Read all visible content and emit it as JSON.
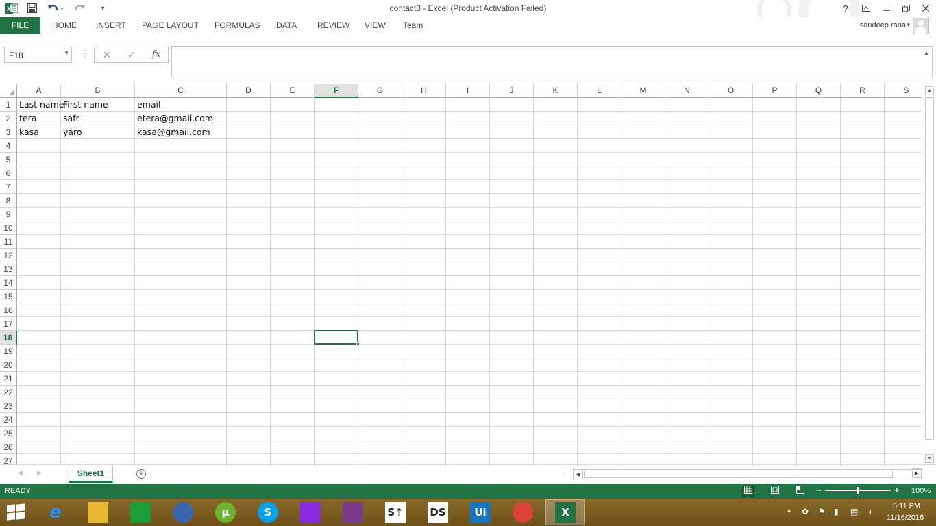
{
  "window": {
    "title": "contact3 - Excel (Product Activation Failed)",
    "help": "?",
    "user_name": "sandeep rana"
  },
  "ribbon": {
    "file": "FILE",
    "tabs": [
      "HOME",
      "INSERT",
      "PAGE LAYOUT",
      "FORMULAS",
      "DATA",
      "REVIEW",
      "VIEW",
      "Team"
    ]
  },
  "formula_bar": {
    "name_box": "F18",
    "fx_label": "fx",
    "cancel_glyph": "✕",
    "enter_glyph": "✓",
    "value": ""
  },
  "grid": {
    "columns": [
      "A",
      "B",
      "C",
      "D",
      "E",
      "F",
      "G",
      "H",
      "I",
      "J",
      "K",
      "L",
      "M",
      "N",
      "O",
      "P",
      "Q",
      "R",
      "S"
    ],
    "rows": [
      "1",
      "2",
      "3",
      "4",
      "5",
      "6",
      "7",
      "8",
      "9",
      "10",
      "11",
      "12",
      "13",
      "14",
      "15",
      "16",
      "17",
      "18",
      "19",
      "20",
      "21",
      "22",
      "23",
      "24",
      "25",
      "26",
      "27"
    ],
    "active_column": "F",
    "active_row": "18",
    "data": [
      [
        "Last name",
        "First name",
        "email"
      ],
      [
        "tera",
        "safr",
        "etera@gmail.com"
      ],
      [
        "kasa",
        "yaro",
        "kasa@gmail.com"
      ]
    ]
  },
  "sheets": {
    "tabs": [
      "Sheet1"
    ],
    "add_label": "+"
  },
  "status": {
    "text": "READY",
    "zoom_level": "100%",
    "zoom_minus": "−",
    "zoom_plus": "+",
    "zoom_fraction": 0.5
  },
  "taskbar": {
    "apps": [
      {
        "name": "internet-explorer",
        "label": "e",
        "color": "#1e90ff"
      },
      {
        "name": "file-explorer",
        "label": "",
        "color": "#e8b830"
      },
      {
        "name": "windows-store",
        "label": "",
        "color": "#1a9e3c"
      },
      {
        "name": "thunderbird",
        "label": "",
        "color": "#3a66b0"
      },
      {
        "name": "utorrent",
        "label": "µ",
        "color": "#6bb22e"
      },
      {
        "name": "skype",
        "label": "S",
        "color": "#00a2ed"
      },
      {
        "name": "search-app",
        "label": "",
        "color": "#8a2be2"
      },
      {
        "name": "winrar",
        "label": "",
        "color": "#7a3a8a"
      },
      {
        "name": "st-app",
        "label": "S↑",
        "color": "#ffffff"
      },
      {
        "name": "ds-app",
        "label": "DS",
        "color": "#ffffff"
      },
      {
        "name": "uipath",
        "label": "Ui",
        "color": "#1a73c0"
      },
      {
        "name": "chrome",
        "label": "",
        "color": "#db4437"
      },
      {
        "name": "excel",
        "label": "X",
        "color": "#217346"
      }
    ],
    "time": "5:11 PM",
    "date": "11/16/2016"
  }
}
